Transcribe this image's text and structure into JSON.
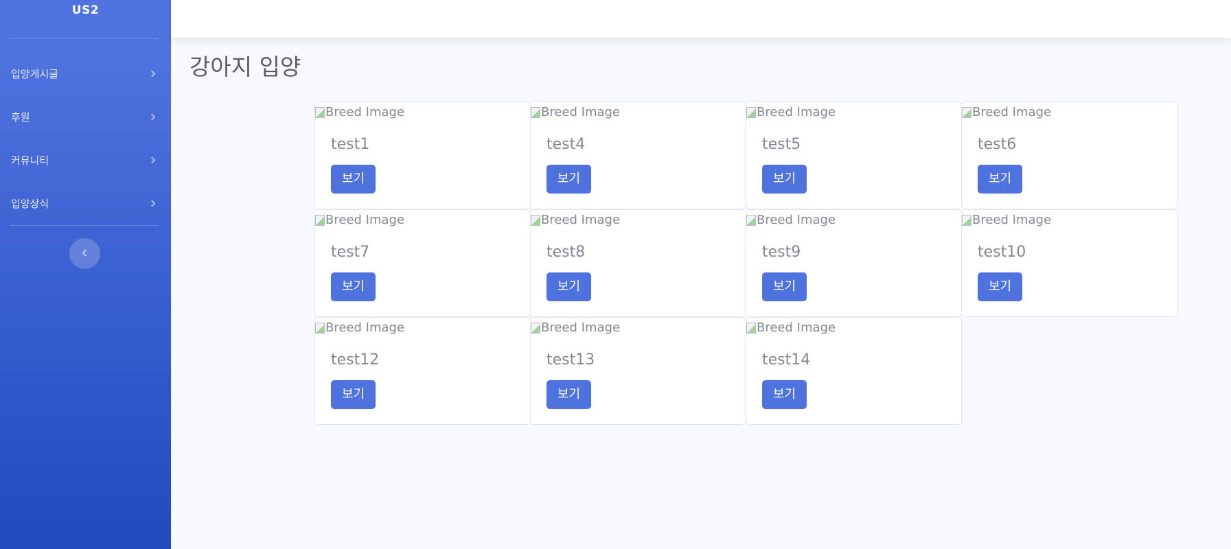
{
  "sidebar": {
    "brand": "US2",
    "items": [
      {
        "label": "입양게시글"
      },
      {
        "label": "후원"
      },
      {
        "label": "커뮤니티"
      },
      {
        "label": "입양상식"
      }
    ]
  },
  "page": {
    "title": "강아지 입양"
  },
  "cards": [
    {
      "image_alt": "Breed Image",
      "title": "test1",
      "button": "보기"
    },
    {
      "image_alt": "Breed Image",
      "title": "test4",
      "button": "보기"
    },
    {
      "image_alt": "Breed Image",
      "title": "test5",
      "button": "보기"
    },
    {
      "image_alt": "Breed Image",
      "title": "test6",
      "button": "보기"
    },
    {
      "image_alt": "Breed Image",
      "title": "test7",
      "button": "보기"
    },
    {
      "image_alt": "Breed Image",
      "title": "test8",
      "button": "보기"
    },
    {
      "image_alt": "Breed Image",
      "title": "test9",
      "button": "보기"
    },
    {
      "image_alt": "Breed Image",
      "title": "test10",
      "button": "보기"
    },
    {
      "image_alt": "Breed Image",
      "title": "test12",
      "button": "보기"
    },
    {
      "image_alt": "Breed Image",
      "title": "test13",
      "button": "보기"
    },
    {
      "image_alt": "Breed Image",
      "title": "test14",
      "button": "보기"
    }
  ],
  "colors": {
    "primary": "#4e73df",
    "sidebar_gradient_end": "#224abe",
    "page_background": "#f8f9fc",
    "text_muted": "#858796",
    "title_text": "#5a5c69"
  }
}
